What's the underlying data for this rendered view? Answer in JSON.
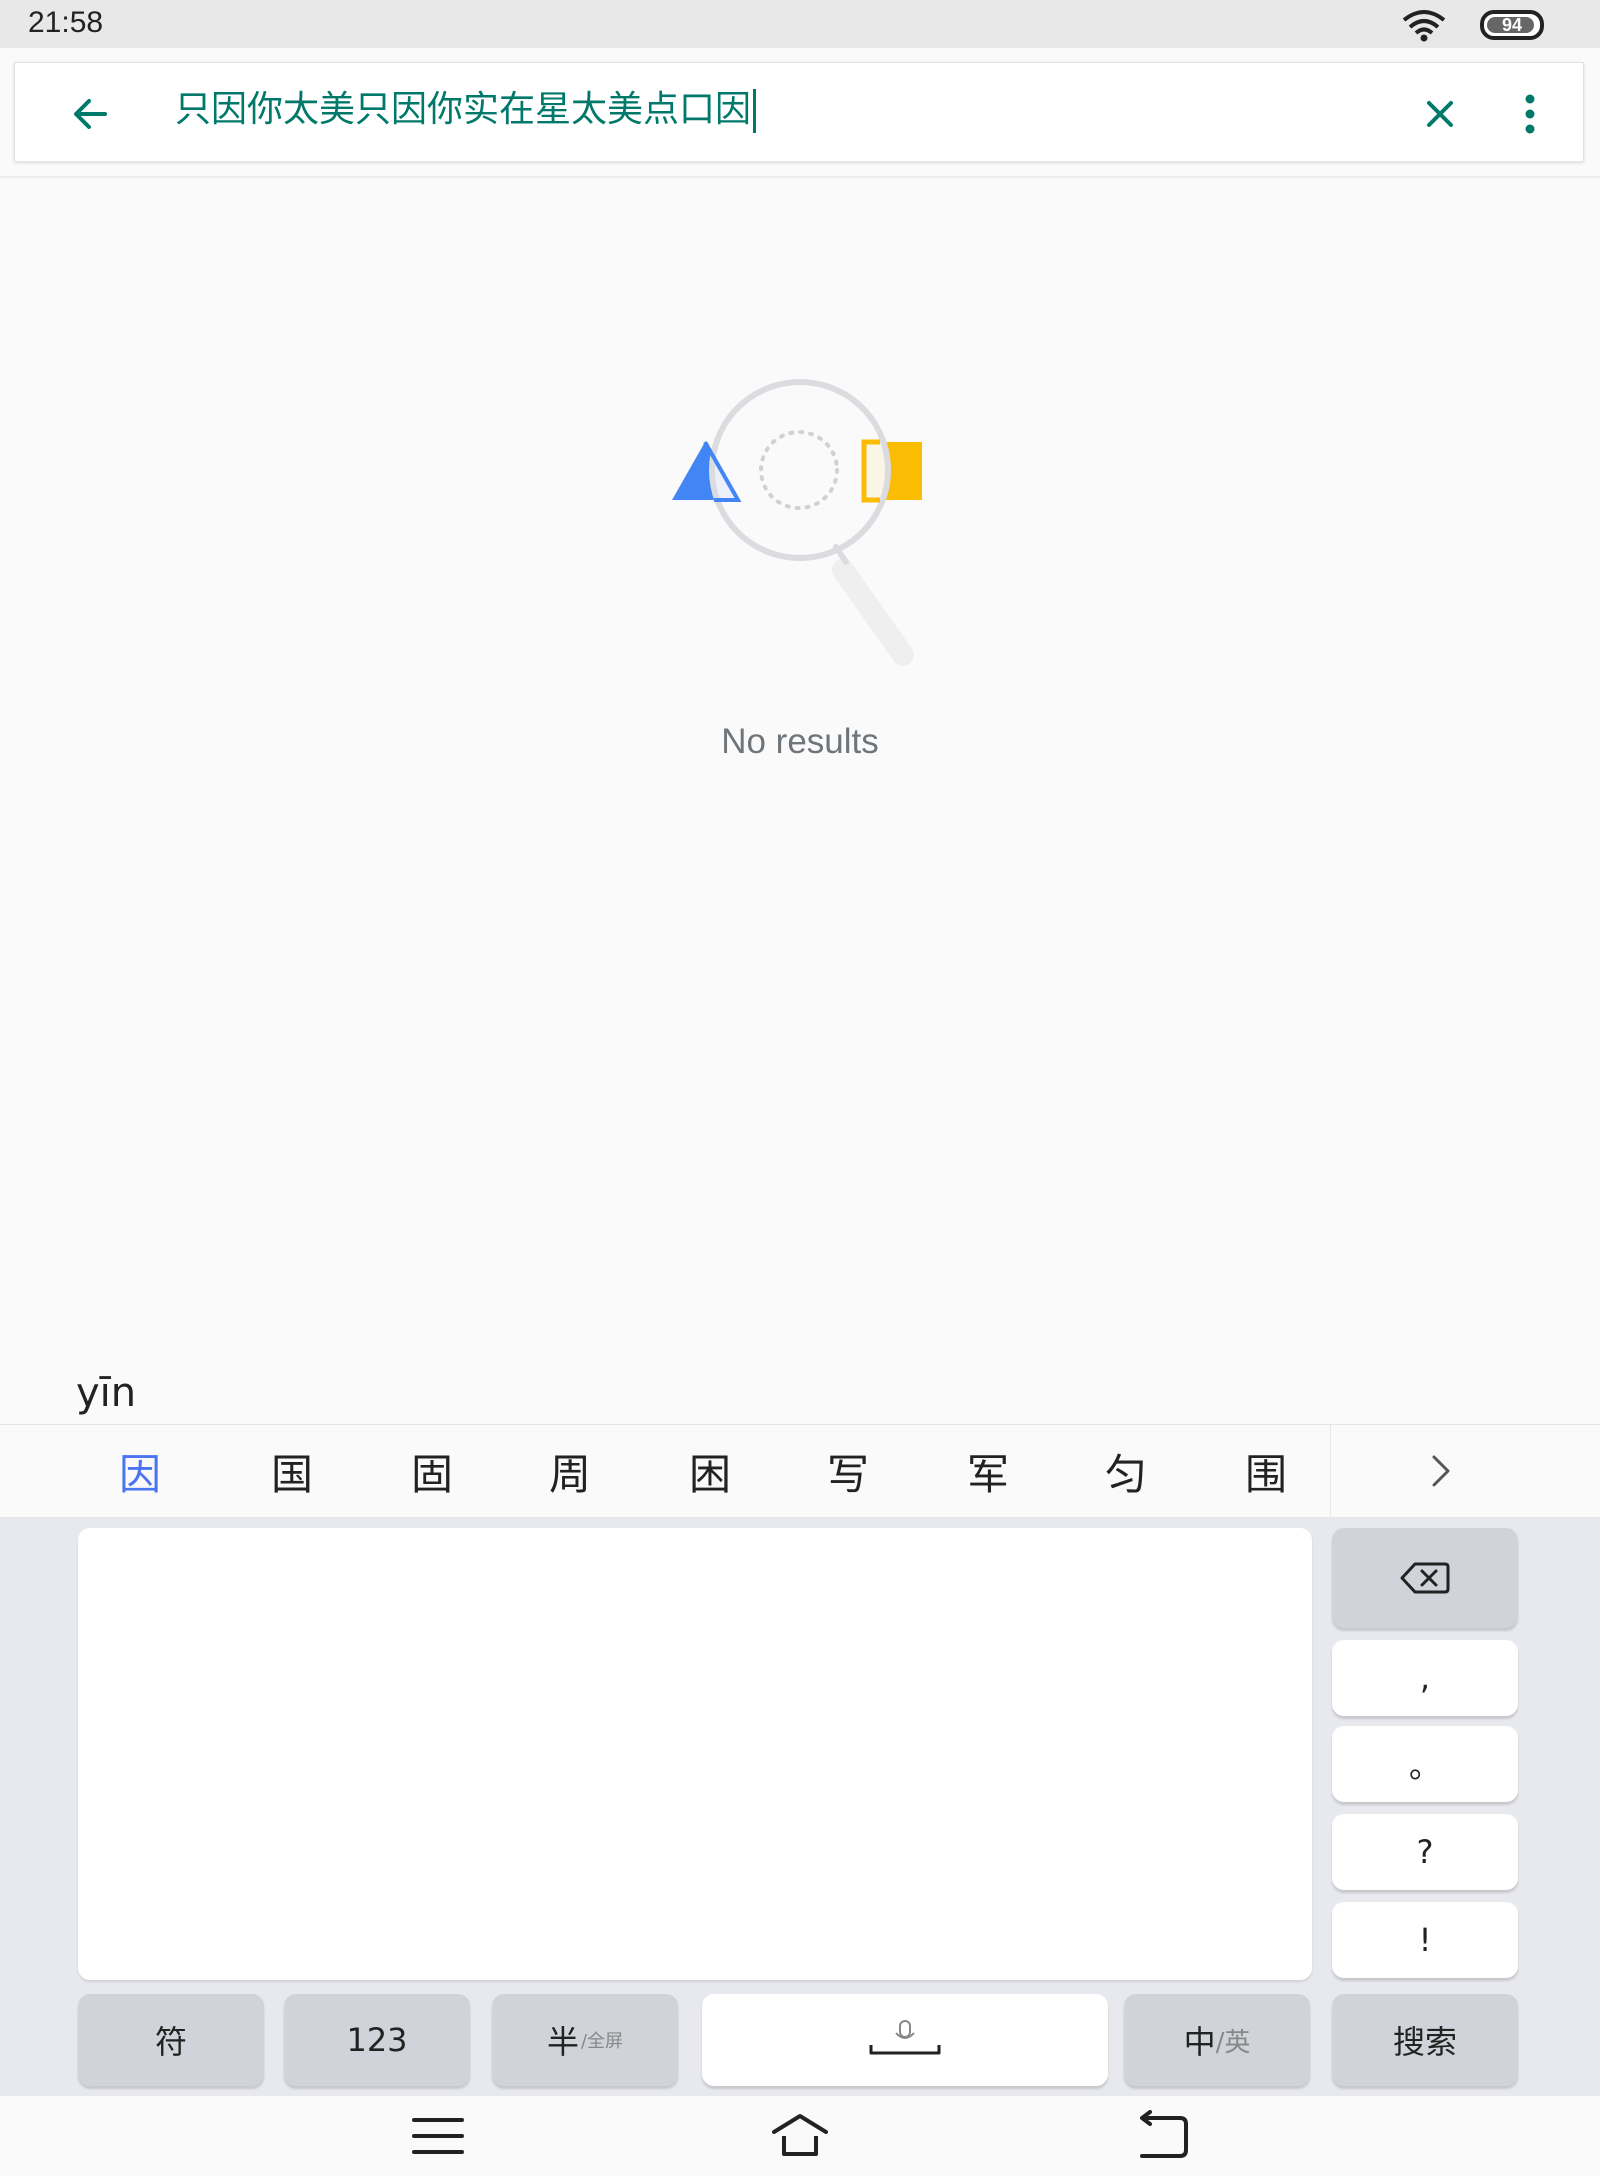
{
  "status_bar": {
    "time": "21:58",
    "battery_level": "94",
    "icons": [
      "wifi-icon",
      "battery-icon"
    ]
  },
  "search": {
    "query": "只因你太美只因你实在星太美点口因",
    "icons": [
      "back-arrow-icon",
      "clear-icon",
      "more-vert-icon"
    ]
  },
  "empty_state": {
    "message": "No results",
    "colors": {
      "triangle": "#4285f4",
      "square": "#fbbc04",
      "lens": "#dadce0"
    }
  },
  "ime": {
    "pinyin": "yīn",
    "candidates": [
      "因",
      "国",
      "固",
      "周",
      "困",
      "写",
      "军",
      "匀",
      "围"
    ],
    "side_keys": [
      ",",
      "。",
      "?",
      "!"
    ],
    "bottom_keys": {
      "symbols": "符",
      "numbers": "123",
      "half_main": "半",
      "half_sub": "/全屏",
      "lang_main": "中",
      "lang_sub": "/英",
      "search": "搜索"
    },
    "accent_color": "#4a74f0"
  },
  "nav_bar": {
    "icons": [
      "menu-icon",
      "home-icon",
      "back-icon"
    ]
  }
}
